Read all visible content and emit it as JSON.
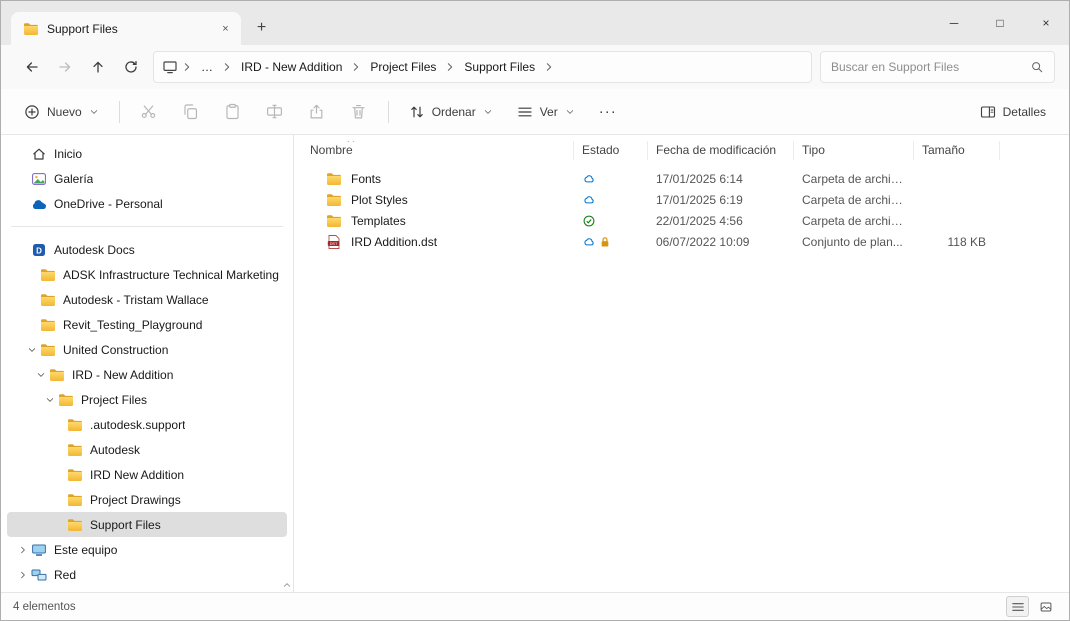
{
  "window": {
    "tab_title": "Support Files",
    "tab_close_glyph": "×",
    "new_tab_glyph": "+",
    "controls": {
      "minimize": "─",
      "maximize": "□",
      "close": "×"
    }
  },
  "nav": {
    "breadcrumb": {
      "ellipsis": "…",
      "items": [
        "IRD - New Addition",
        "Project Files",
        "Support Files"
      ]
    },
    "search": {
      "placeholder": "Buscar en Support Files"
    }
  },
  "toolbar": {
    "new_label": "Nuevo",
    "sort_label": "Ordenar",
    "view_label": "Ver",
    "more_glyph": "···",
    "details_label": "Detalles"
  },
  "sidebar": {
    "items": [
      {
        "label": "Inicio",
        "icon": "home",
        "indent": 0,
        "chevron": "none"
      },
      {
        "label": "Galería",
        "icon": "gallery",
        "indent": 0,
        "chevron": "none"
      },
      {
        "label": "OneDrive - Personal",
        "icon": "onedrive",
        "indent": 0,
        "chevron": "none"
      },
      {
        "label": "Autodesk Docs",
        "icon": "adocs",
        "indent": 0,
        "chevron": "none",
        "separator_before": true
      },
      {
        "label": "ADSK Infrastructure Technical Marketing",
        "icon": "folder",
        "indent": 1,
        "chevron": "none"
      },
      {
        "label": "Autodesk - Tristam Wallace",
        "icon": "folder",
        "indent": 1,
        "chevron": "none"
      },
      {
        "label": "Revit_Testing_Playground",
        "icon": "folder",
        "indent": 1,
        "chevron": "none"
      },
      {
        "label": "United Construction",
        "icon": "folder",
        "indent": 1,
        "chevron": "expanded"
      },
      {
        "label": "IRD - New Addition",
        "icon": "folder",
        "indent": 2,
        "chevron": "expanded"
      },
      {
        "label": "Project Files",
        "icon": "folder",
        "indent": 3,
        "chevron": "expanded"
      },
      {
        "label": ".autodesk.support",
        "icon": "folder",
        "indent": 4,
        "chevron": "none"
      },
      {
        "label": "Autodesk",
        "icon": "folder",
        "indent": 4,
        "chevron": "none"
      },
      {
        "label": "IRD New Addition",
        "icon": "folder",
        "indent": 4,
        "chevron": "none"
      },
      {
        "label": "Project Drawings",
        "icon": "folder",
        "indent": 4,
        "chevron": "none"
      },
      {
        "label": "Support Files",
        "icon": "folder",
        "indent": 4,
        "chevron": "none",
        "selected": true
      },
      {
        "label": "Este equipo",
        "icon": "computer",
        "indent": 0,
        "chevron": "collapsed"
      },
      {
        "label": "Red",
        "icon": "network",
        "indent": 0,
        "chevron": "collapsed"
      }
    ]
  },
  "files": {
    "columns": [
      {
        "id": "nombre",
        "label": "Nombre"
      },
      {
        "id": "estado",
        "label": "Estado"
      },
      {
        "id": "fecha",
        "label": "Fecha de modificación"
      },
      {
        "id": "tipo",
        "label": "Tipo"
      },
      {
        "id": "tamano",
        "label": "Tamaño"
      }
    ],
    "rows": [
      {
        "name": "Fonts",
        "icon": "folder",
        "status": [
          "cloud"
        ],
        "modified": "17/01/2025 6:14",
        "type": "Carpeta de archivos",
        "size": ""
      },
      {
        "name": "Plot Styles",
        "icon": "folder",
        "status": [
          "cloud"
        ],
        "modified": "17/01/2025 6:19",
        "type": "Carpeta de archivos",
        "size": ""
      },
      {
        "name": "Templates",
        "icon": "folder",
        "status": [
          "check"
        ],
        "modified": "22/01/2025 4:56",
        "type": "Carpeta de archivos",
        "size": ""
      },
      {
        "name": "IRD Addition.dst",
        "icon": "dst",
        "status": [
          "cloud",
          "lock"
        ],
        "modified": "06/07/2022 10:09",
        "type": "Conjunto de plan...",
        "size": "118 KB"
      }
    ]
  },
  "statusbar": {
    "items_count": "4 elementos"
  }
}
